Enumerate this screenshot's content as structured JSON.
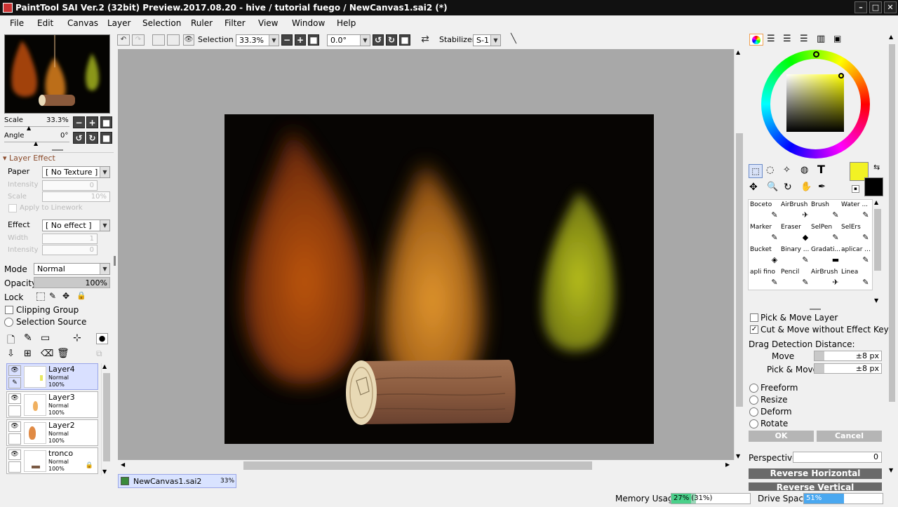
{
  "window": {
    "title": "PaintTool SAI Ver.2 (32bit) Preview.2017.08.20 - hive / tutorial fuego / NewCanvas1.sai2 (*)"
  },
  "menu": [
    "File",
    "Edit",
    "Canvas",
    "Layer",
    "Selection",
    "Ruler",
    "Filter",
    "View",
    "Window",
    "Help"
  ],
  "toolbar": {
    "selection_label": "Selection",
    "zoom": "33.3%",
    "angle": "0.0°",
    "stabilizer_label": "Stabilizer",
    "stabilizer_value": "S-1"
  },
  "navigator": {
    "scale_label": "Scale",
    "scale_value": "33.3%",
    "angle_label": "Angle",
    "angle_value": "0°"
  },
  "layer_effect": {
    "header": "Layer Effect",
    "paper_label": "Paper",
    "paper_value": "[ No Texture ]",
    "intensity_label": "Intensity",
    "intensity_value": "0",
    "scale_label": "Scale",
    "scale_value": "10%",
    "apply_label": "Apply to Linework",
    "effect_label": "Effect",
    "effect_value": "[ No effect ]",
    "width_label": "Width",
    "width_value": "1",
    "intensity2_label": "Intensity",
    "intensity2_value": "0"
  },
  "layer_props": {
    "mode_label": "Mode",
    "mode_value": "Normal",
    "opacity_label": "Opacity",
    "opacity_value": "100%",
    "lock_label": "Lock",
    "clipping_label": "Clipping Group",
    "selection_source_label": "Selection Source"
  },
  "layers": [
    {
      "name": "Layer4",
      "mode": "Normal",
      "opacity": "100%",
      "selected": true
    },
    {
      "name": "Layer3",
      "mode": "Normal",
      "opacity": "100%",
      "selected": false
    },
    {
      "name": "Layer2",
      "mode": "Normal",
      "opacity": "100%",
      "selected": false
    },
    {
      "name": "tronco",
      "mode": "Normal",
      "opacity": "100%",
      "selected": false
    }
  ],
  "doc_tab": {
    "name": "NewCanvas1.sai2",
    "zoom": "33%"
  },
  "colors": {
    "primary": "#f2f224",
    "secondary": "#000000",
    "accent": "#f0a050"
  },
  "tools": [
    {
      "name": "Boceto",
      "icon": "✎"
    },
    {
      "name": "AirBrush",
      "icon": "✈"
    },
    {
      "name": "Brush",
      "icon": "✎"
    },
    {
      "name": "Water ...",
      "icon": "✎"
    },
    {
      "name": "Marker",
      "icon": "✎"
    },
    {
      "name": "Eraser",
      "icon": "◆"
    },
    {
      "name": "SelPen",
      "icon": "✎"
    },
    {
      "name": "SelErs",
      "icon": "✎"
    },
    {
      "name": "Bucket",
      "icon": "◈"
    },
    {
      "name": "Binary ...",
      "icon": "✎"
    },
    {
      "name": "Gradati...",
      "icon": "▬"
    },
    {
      "name": "aplicar ...",
      "icon": "✎"
    },
    {
      "name": "apli fino",
      "icon": "✎"
    },
    {
      "name": "Pencil",
      "icon": "✎"
    },
    {
      "name": "AirBrush",
      "icon": "✈"
    },
    {
      "name": "Linea",
      "icon": "✎"
    }
  ],
  "move_tool": {
    "pick_move_layer": "Pick & Move Layer",
    "cut_move": "Cut & Move without Effect Key",
    "drag_label": "Drag Detection Distance:",
    "move_label": "Move",
    "move_value": "±8 px",
    "pick_label": "Pick & Move",
    "pick_value": "±8 px"
  },
  "transform": {
    "freeform": "Freeform",
    "resize": "Resize",
    "deform": "Deform",
    "rotate": "Rotate",
    "ok": "OK",
    "cancel": "Cancel",
    "perspective_label": "Perspective",
    "perspective_value": "0",
    "reverse_h": "Reverse Horizontal",
    "reverse_v": "Reverse Vertical"
  },
  "status": {
    "memory_label": "Memory Usage",
    "memory_value": "27% (31%)",
    "memory_fraction": 0.27,
    "drive_label": "Drive Space",
    "drive_value": "51%",
    "drive_fraction": 0.51
  }
}
